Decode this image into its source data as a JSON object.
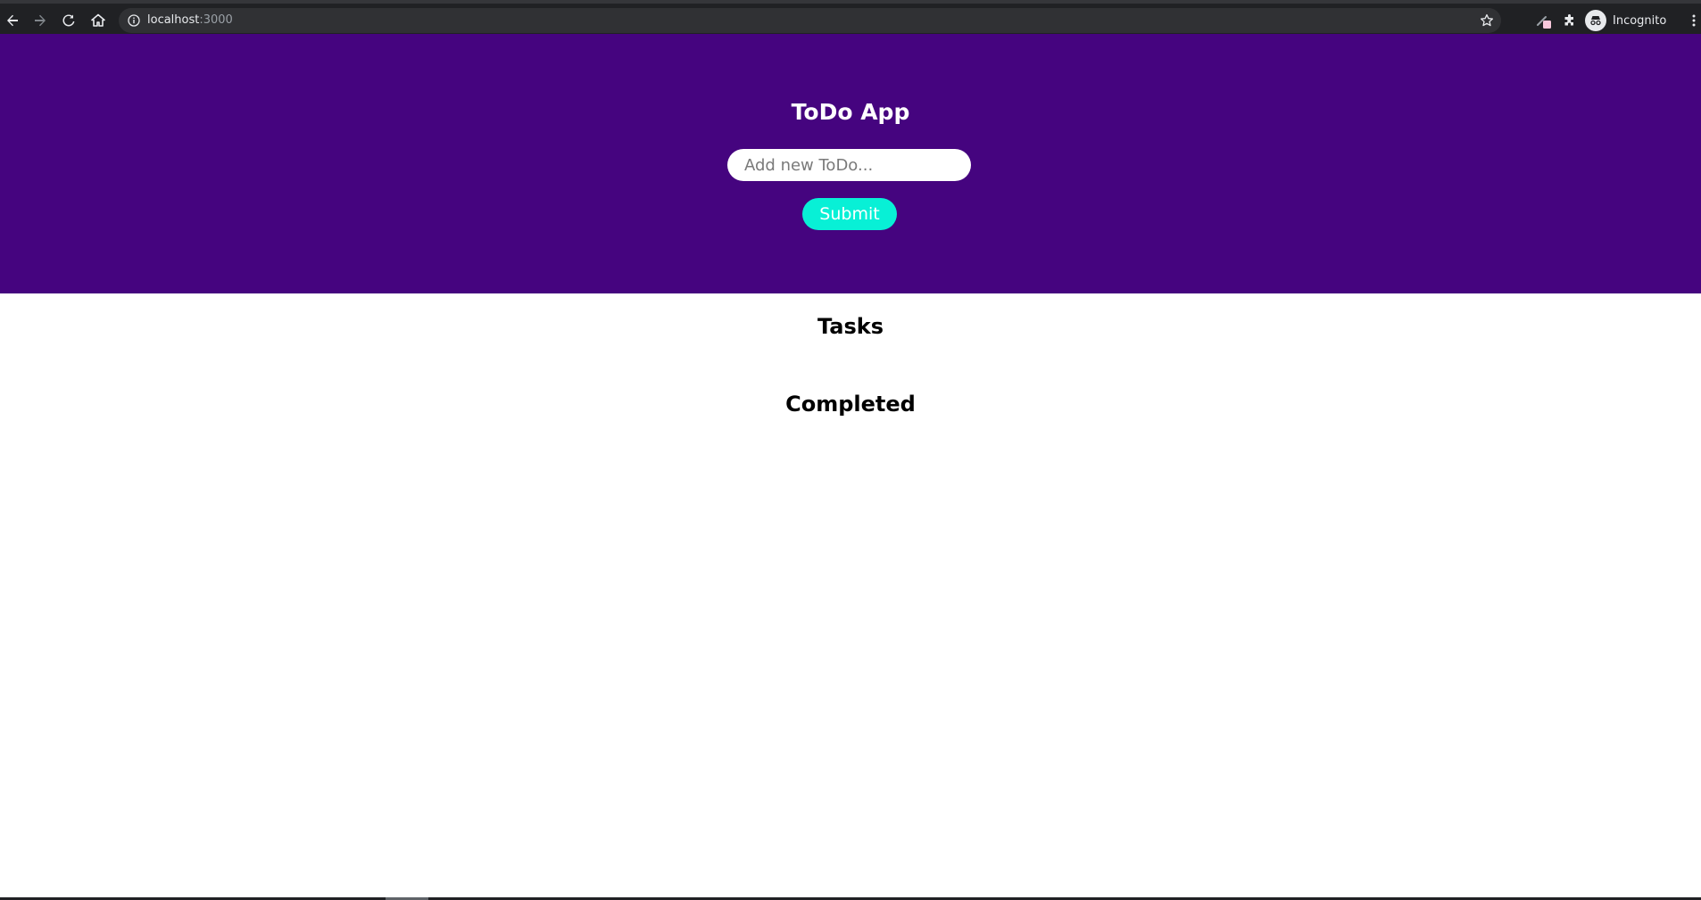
{
  "browser": {
    "url_host": "localhost",
    "url_port": ":3000",
    "profile_label": "Incognito",
    "icons": {
      "back": "arrow-left-icon",
      "forward": "arrow-right-icon",
      "reload": "reload-icon",
      "home": "home-icon",
      "site_info": "info-icon",
      "bookmark": "star-icon",
      "extension_1": "pencil-icon",
      "extensions": "puzzle-icon",
      "profile": "incognito-icon",
      "menu": "kebab-menu-icon"
    }
  },
  "app": {
    "title": "ToDo App",
    "input": {
      "placeholder": "Add new ToDo...",
      "value": ""
    },
    "submit_label": "Submit",
    "tasks_heading": "Tasks",
    "completed_heading": "Completed",
    "tasks": [],
    "completed": []
  },
  "colors": {
    "hero_background": "#45047f",
    "submit_background": "#08f0d6",
    "page_background": "#ffffff",
    "browser_chrome": "#202124"
  }
}
